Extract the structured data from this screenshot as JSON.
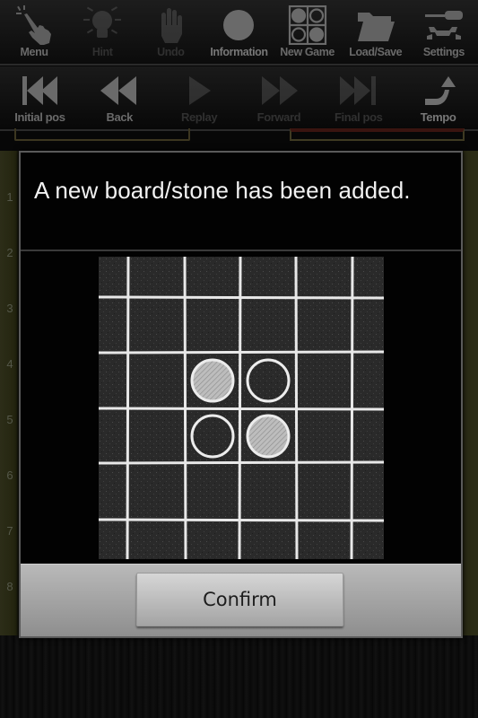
{
  "toolbar_top": {
    "items": [
      {
        "label": "Menu",
        "icon": "pointing-hand-icon",
        "enabled": true
      },
      {
        "label": "Hint",
        "icon": "lightbulb-icon",
        "enabled": false
      },
      {
        "label": "Undo",
        "icon": "hand-icon",
        "enabled": false
      },
      {
        "label": "Information",
        "icon": "circle-icon",
        "enabled": true
      },
      {
        "label": "New Game",
        "icon": "new-board-icon",
        "enabled": true
      },
      {
        "label": "Load/Save",
        "icon": "folder-icon",
        "enabled": true
      },
      {
        "label": "Settings",
        "icon": "wrench-screwdriver-icon",
        "enabled": true
      }
    ]
  },
  "toolbar_playback": {
    "items": [
      {
        "label": "Initial pos",
        "icon": "skip-to-start-icon",
        "enabled": true
      },
      {
        "label": "Back",
        "icon": "rewind-icon",
        "enabled": true
      },
      {
        "label": "Replay",
        "icon": "play-icon",
        "enabled": false
      },
      {
        "label": "Forward",
        "icon": "fast-forward-icon",
        "enabled": false
      },
      {
        "label": "Final pos",
        "icon": "skip-to-end-icon",
        "enabled": false
      },
      {
        "label": "Tempo",
        "icon": "curved-arrow-up-icon",
        "enabled": true
      }
    ]
  },
  "board": {
    "row_labels": [
      "1",
      "2",
      "3",
      "4",
      "5",
      "6",
      "7",
      "8"
    ]
  },
  "dialog": {
    "message": "A new board/stone has been added.",
    "preview": {
      "description": "chalkboard-style board with four stones",
      "stones": [
        {
          "row": 0,
          "col": 0,
          "color": "white"
        },
        {
          "row": 0,
          "col": 1,
          "color": "black"
        },
        {
          "row": 1,
          "col": 0,
          "color": "black"
        },
        {
          "row": 1,
          "col": 1,
          "color": "white"
        }
      ]
    },
    "confirm_label": "Confirm"
  },
  "colors": {
    "toolbar_label": "#6a6a6a",
    "dialog_text": "#f2f2f2",
    "chalk": "#e8e8e8",
    "board_surface": "#2b2b2b",
    "footer": "#a8a8a8"
  }
}
